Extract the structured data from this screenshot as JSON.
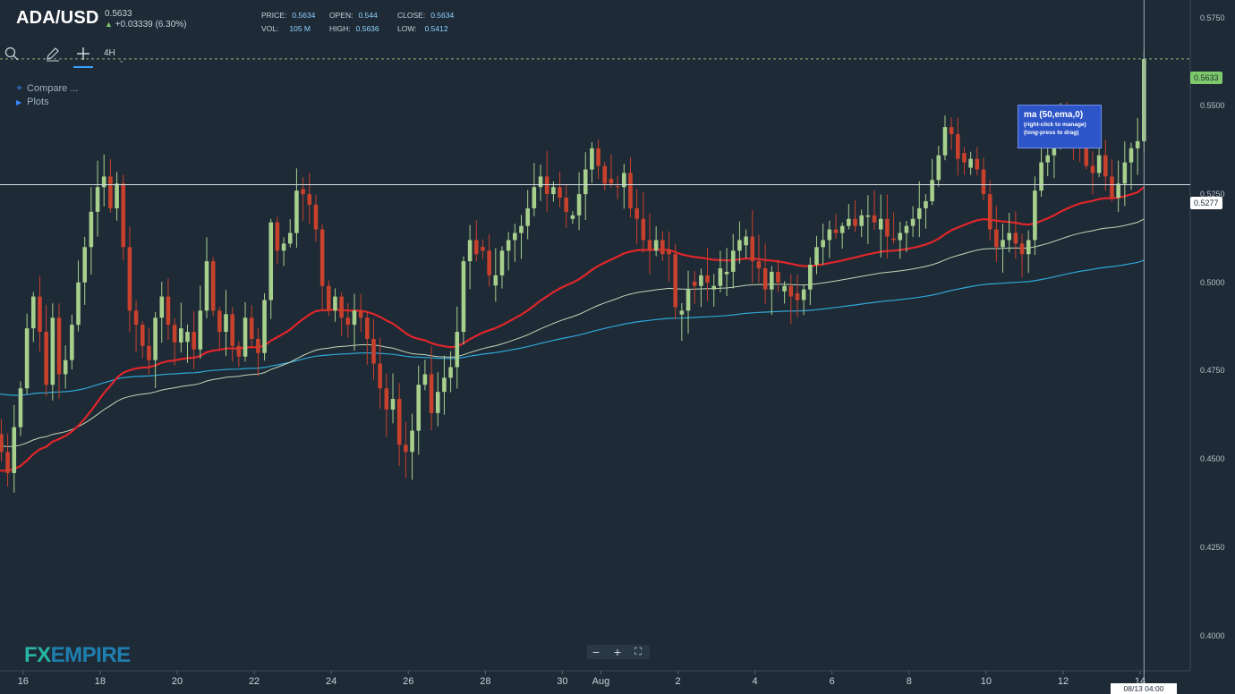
{
  "header": {
    "symbol": "ADA/USD",
    "price": "0.5633",
    "change": "+0.03339 (6.30%)",
    "change_arrow": "▲",
    "ohlc": [
      {
        "label": "PRICE:",
        "value": "0.5634"
      },
      {
        "label": "OPEN:",
        "value": "0.544"
      },
      {
        "label": "CLOSE:",
        "value": "0.5634"
      },
      {
        "label": "VOL:",
        "value": "105 M"
      },
      {
        "label": "HIGH:",
        "value": "0.5636"
      },
      {
        "label": "LOW:",
        "value": "0.5412"
      }
    ]
  },
  "toolbar": {
    "timeframe": "4H",
    "caret": "⌄",
    "search_icon": "search-icon",
    "draw_icon": "pencil-icon",
    "crosshair_icon": "crosshair-icon"
  },
  "menu": {
    "compare_icon": "+",
    "compare": "Compare ...",
    "plots_icon": "▶",
    "plots": "Plots"
  },
  "tooltip": {
    "title": "ma (50,ema,0)",
    "line1": "(right-click to manage)",
    "line2": "(long-press to drag)"
  },
  "logo": {
    "fx": "FX",
    "empire": "EMPIRE"
  },
  "zoom": {
    "minus": "−",
    "plus": "+",
    "fit": "⛶"
  },
  "labels": {
    "last_price": "0.5633",
    "crosshair_price": "0.5277",
    "crosshair_time": "08/13 04:00"
  },
  "colors": {
    "background": "#1e2a36",
    "up_candle": "#a8d08d",
    "down_candle": "#c8412c",
    "ema50": "#e0262a",
    "ma100": "#c2d8b8",
    "ma200": "#2fa8d8"
  },
  "chart_data": {
    "type": "candlestick",
    "ylim": [
      0.39,
      0.58
    ],
    "y_ticks": [
      "0.5750",
      "0.5500",
      "0.5250",
      "0.5000",
      "0.4750",
      "0.4500",
      "0.4250",
      "0.4000"
    ],
    "x_ticks": [
      "16",
      "18",
      "20",
      "22",
      "24",
      "26",
      "28",
      "30",
      "Aug",
      "2",
      "4",
      "6",
      "8",
      "10",
      "12",
      "14"
    ],
    "x_range_days": [
      15.4,
      46.3
    ],
    "x_tick_days": [
      16,
      18,
      20,
      22,
      24,
      26,
      28,
      30,
      31,
      33,
      35,
      37,
      39,
      41,
      43,
      45
    ],
    "candle_interval": "4H",
    "last_price": 0.5633,
    "crosshair_price": 0.5277,
    "closes": [
      0.435,
      0.437,
      0.442,
      0.438,
      0.44,
      0.447,
      0.445,
      0.444,
      0.442,
      0.437,
      0.434,
      0.437,
      0.436,
      0.446,
      0.448,
      0.457,
      0.458,
      0.454,
      0.448,
      0.456,
      0.457,
      0.452,
      0.446,
      0.459,
      0.47,
      0.487,
      0.496,
      0.486,
      0.471,
      0.49,
      0.474,
      0.478,
      0.488,
      0.5,
      0.51,
      0.52,
      0.527,
      0.53,
      0.521,
      0.528,
      0.51,
      0.492,
      0.488,
      0.482,
      0.478,
      0.49,
      0.496,
      0.488,
      0.483,
      0.487,
      0.486,
      0.481,
      0.492,
      0.506,
      0.492,
      0.486,
      0.491,
      0.482,
      0.479,
      0.49,
      0.484,
      0.48,
      0.495,
      0.517,
      0.509,
      0.511,
      0.514,
      0.526,
      0.525,
      0.522,
      0.515,
      0.499,
      0.492,
      0.496,
      0.49,
      0.488,
      0.492,
      0.49,
      0.484,
      0.477,
      0.47,
      0.464,
      0.467,
      0.454,
      0.452,
      0.458,
      0.471,
      0.474,
      0.463,
      0.469,
      0.473,
      0.476,
      0.486,
      0.506,
      0.512,
      0.508,
      0.509,
      0.502,
      0.502,
      0.509,
      0.512,
      0.514,
      0.516,
      0.521,
      0.527,
      0.53,
      0.525,
      0.527,
      0.524,
      0.52,
      0.519,
      0.525,
      0.532,
      0.538,
      0.533,
      0.528,
      0.528,
      0.527,
      0.531,
      0.521,
      0.518,
      0.512,
      0.509,
      0.512,
      0.508,
      0.508,
      0.493,
      0.492,
      0.498,
      0.499,
      0.502,
      0.5,
      0.499,
      0.504,
      0.503,
      0.509,
      0.512,
      0.513,
      0.506,
      0.504,
      0.498,
      0.503,
      0.5,
      0.499,
      0.496,
      0.495,
      0.498,
      0.505,
      0.51,
      0.512,
      0.515,
      0.514,
      0.516,
      0.518,
      0.516,
      0.519,
      0.519,
      0.517,
      0.518,
      0.513,
      0.512,
      0.514,
      0.516,
      0.518,
      0.521,
      0.523,
      0.529,
      0.536,
      0.544,
      0.542,
      0.535,
      0.534,
      0.535,
      0.532,
      0.525,
      0.515,
      0.51,
      0.512,
      0.514,
      0.511,
      0.508,
      0.512,
      0.526,
      0.534,
      0.536,
      0.54,
      0.545,
      0.543,
      0.541,
      0.538,
      0.533,
      0.531,
      0.536,
      0.53,
      0.524,
      0.528,
      0.534,
      0.538,
      0.54,
      0.5633
    ]
  }
}
